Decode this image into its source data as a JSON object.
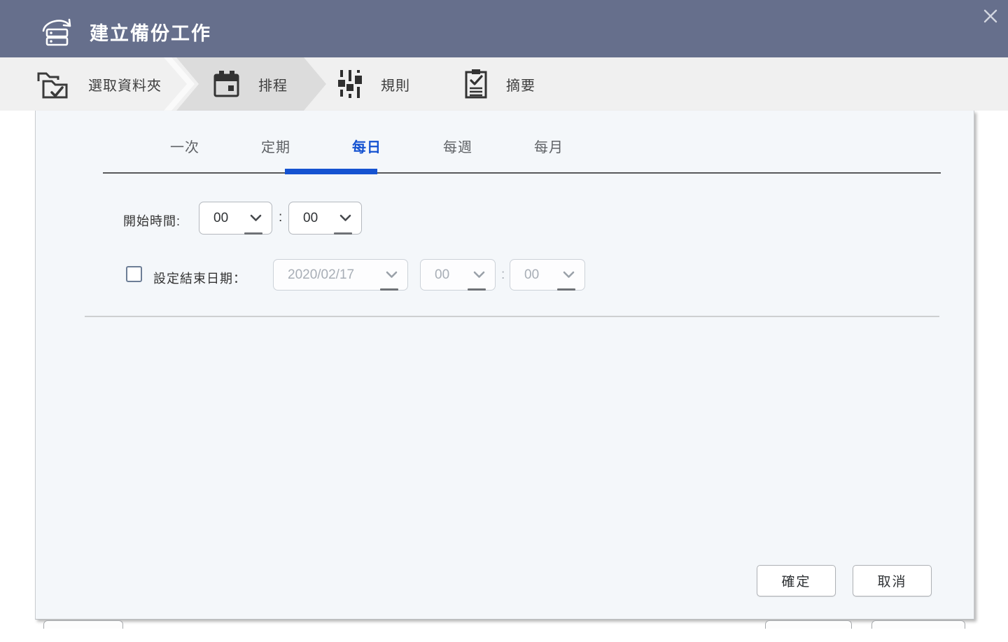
{
  "window": {
    "title": "建立備份工作"
  },
  "steps": {
    "items": [
      {
        "label": "選取資料夾"
      },
      {
        "label": "排程"
      },
      {
        "label": "規則"
      },
      {
        "label": "摘要"
      }
    ],
    "active": "排程"
  },
  "tabs": {
    "items": [
      {
        "label": "一次"
      },
      {
        "label": "定期"
      },
      {
        "label": "每日"
      },
      {
        "label": "每週"
      },
      {
        "label": "每月"
      }
    ],
    "active": "每日"
  },
  "schedule_form": {
    "start_time": {
      "label": "開始時間:",
      "hour": "00",
      "separator": ":",
      "minute": "00"
    },
    "end_date": {
      "label": "設定結束日期：",
      "checked": false,
      "date": "2020/02/17",
      "hour": "00",
      "separator": ":",
      "minute": "00"
    }
  },
  "footer": {
    "ok_label": "確定",
    "cancel_label": "取消"
  },
  "colors": {
    "header_bg": "#666f8c",
    "accent_blue": "#1553d1",
    "active_step_bg": "#dcdcdc",
    "panel_bg": "#f4f7fa"
  }
}
